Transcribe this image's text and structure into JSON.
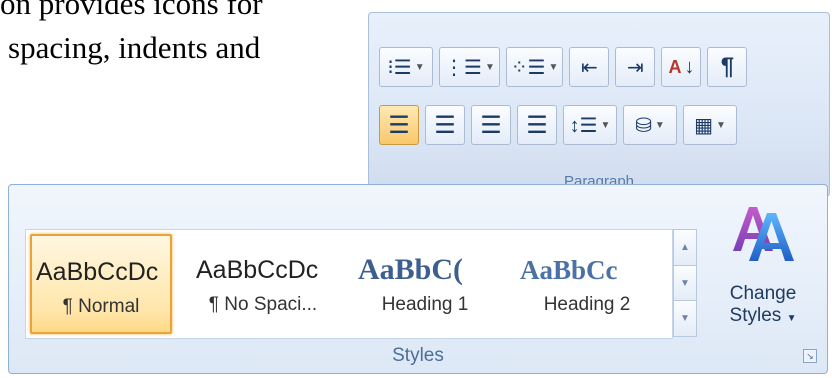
{
  "document": {
    "line1": "on provides icons for",
    "line2": "spacing, indents and"
  },
  "paragraph_group": {
    "label": "Paragraph",
    "row1": [
      {
        "name": "bullets-button",
        "icon": "bullets-icon",
        "glyph": "☰"
      },
      {
        "name": "numbering-button",
        "icon": "numbering-icon",
        "glyph": "☷"
      },
      {
        "name": "multilevel-list-button",
        "icon": "multilevel-list-icon",
        "glyph": "⁝☰"
      },
      {
        "name": "decrease-indent-button",
        "icon": "decrease-indent-icon",
        "glyph": "⇤"
      },
      {
        "name": "increase-indent-button",
        "icon": "increase-indent-icon",
        "glyph": "⇥"
      },
      {
        "name": "sort-button",
        "icon": "sort-icon",
        "glyph": "A↓"
      },
      {
        "name": "show-formatting-button",
        "icon": "pilcrow-icon",
        "glyph": "¶"
      }
    ],
    "row2": [
      {
        "name": "align-left-button",
        "icon": "align-left-icon",
        "glyph": "≡",
        "active": true
      },
      {
        "name": "center-button",
        "icon": "align-center-icon",
        "glyph": "≡"
      },
      {
        "name": "align-right-button",
        "icon": "align-right-icon",
        "glyph": "≡"
      },
      {
        "name": "justify-button",
        "icon": "justify-icon",
        "glyph": "≡"
      },
      {
        "name": "line-spacing-button",
        "icon": "line-spacing-icon",
        "glyph": "↕≡"
      },
      {
        "name": "shading-button",
        "icon": "paint-bucket-icon",
        "glyph": "◭"
      },
      {
        "name": "borders-button",
        "icon": "borders-icon",
        "glyph": "▦"
      }
    ]
  },
  "styles_group": {
    "label": "Styles",
    "gallery": [
      {
        "preview": "AaBbCcDc",
        "name": "¶ Normal",
        "selected": true,
        "variant": "sans"
      },
      {
        "preview": "AaBbCcDc",
        "name": "¶ No Spaci...",
        "selected": false,
        "variant": "sans"
      },
      {
        "preview": "AaBbC(",
        "name": "Heading 1",
        "selected": false,
        "variant": "h1"
      },
      {
        "preview": "AaBbCc",
        "name": "Heading 2",
        "selected": false,
        "variant": "h2"
      }
    ],
    "change_styles": {
      "line1": "Change",
      "line2": "Styles",
      "icon": "change-styles-icon"
    },
    "colors": {
      "selected_border": "#e8a33a",
      "heading_blue": "#3c5f8f"
    }
  }
}
